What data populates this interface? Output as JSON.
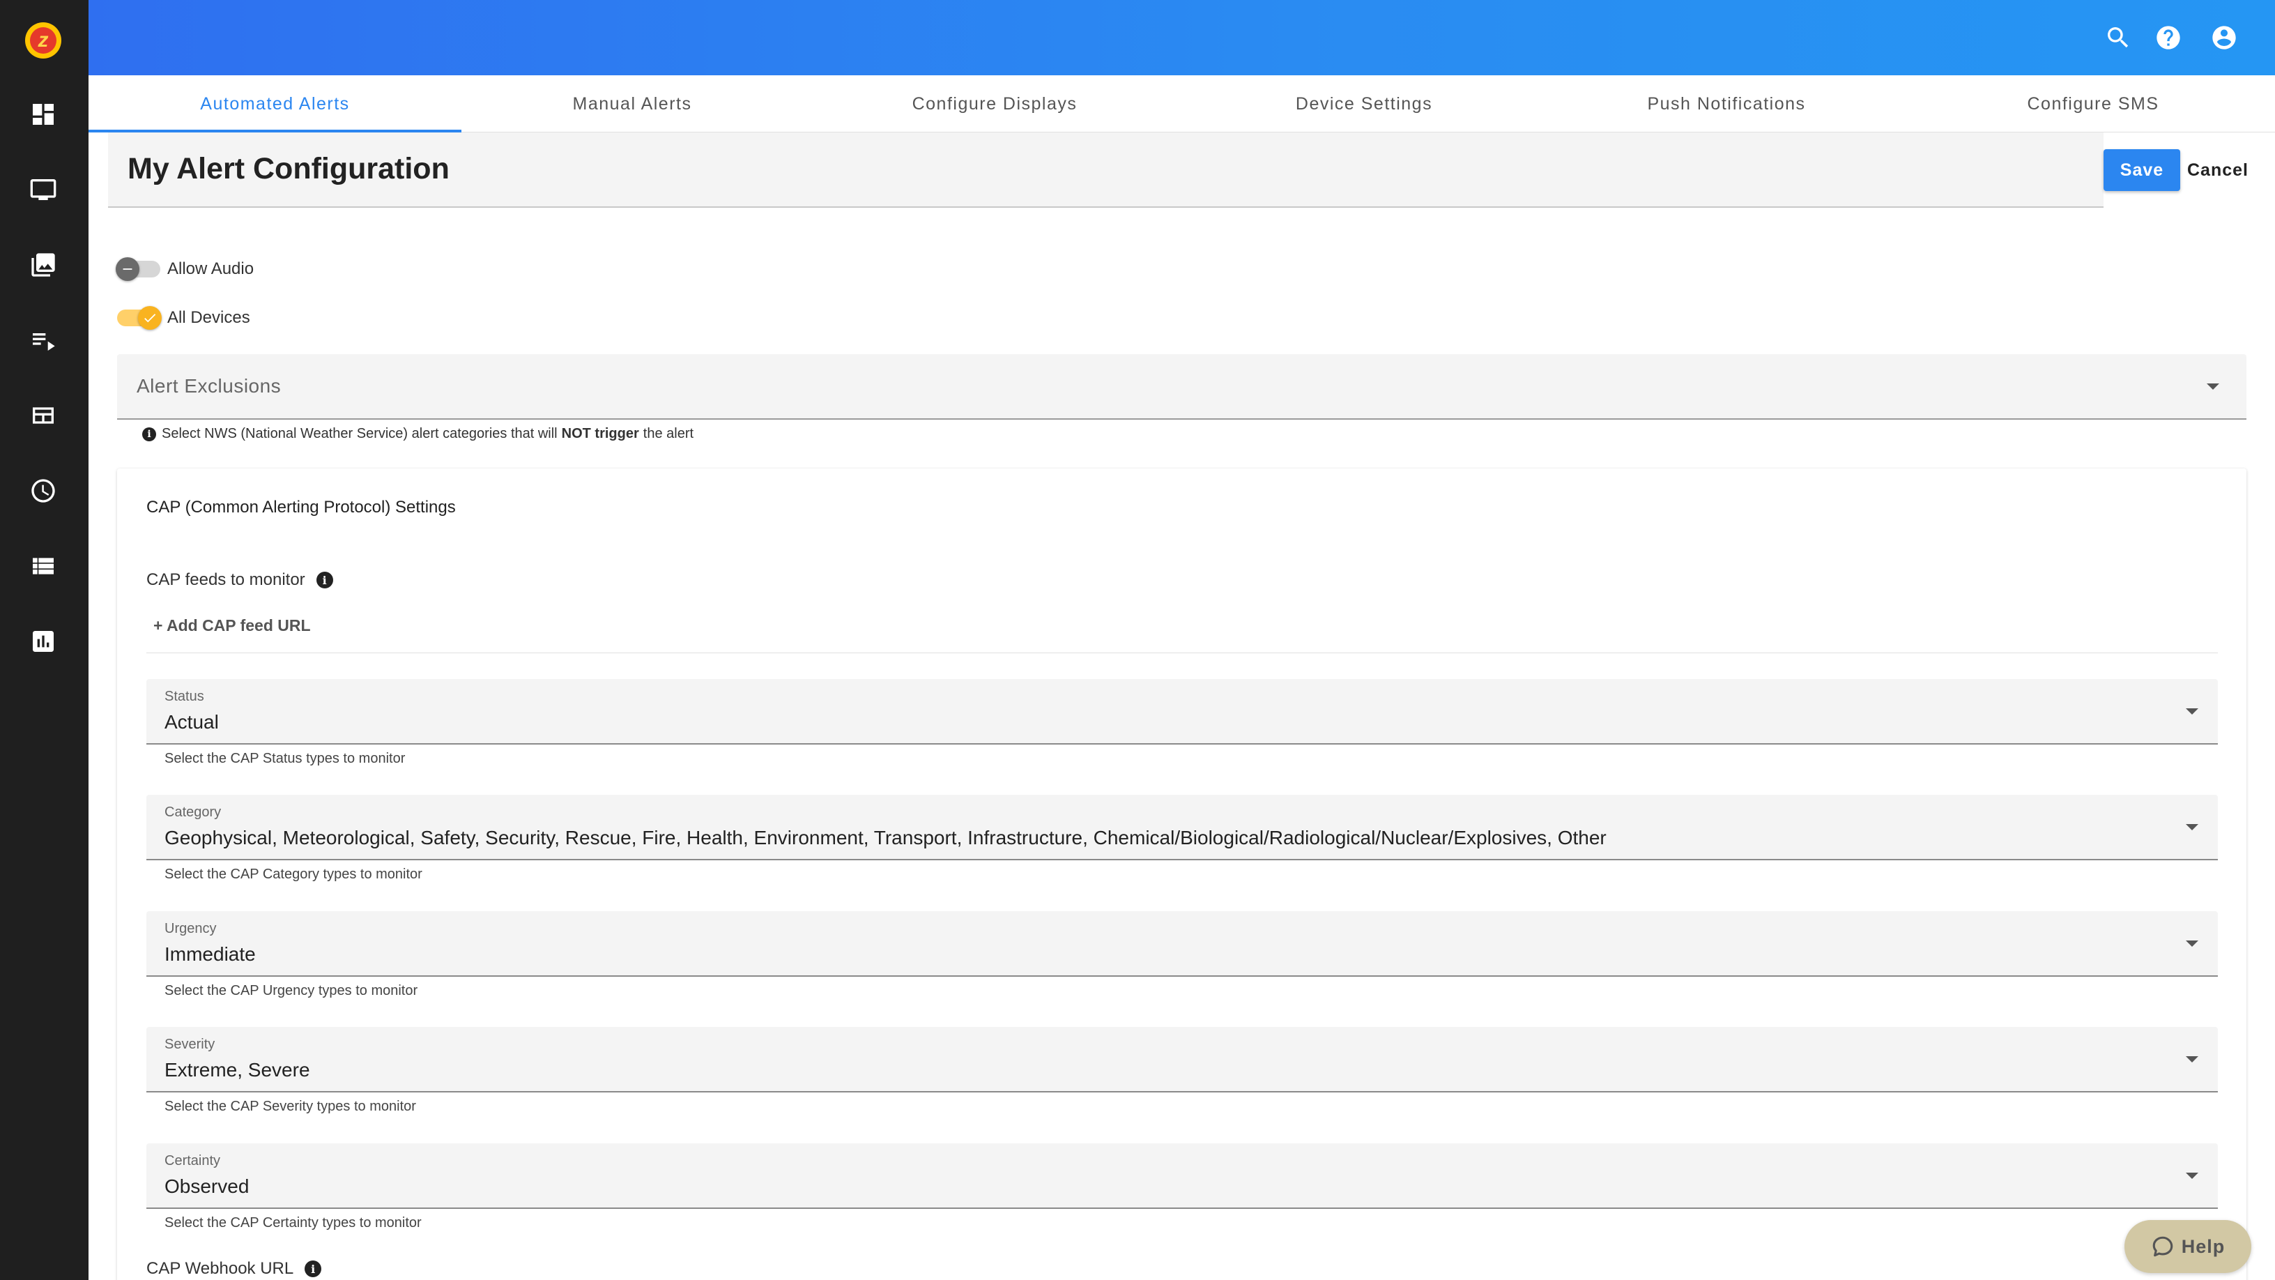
{
  "header": {
    "tabs": [
      {
        "label": "Automated Alerts",
        "active": true
      },
      {
        "label": "Manual Alerts"
      },
      {
        "label": "Configure Displays"
      },
      {
        "label": "Device Settings"
      },
      {
        "label": "Push Notifications"
      },
      {
        "label": "Configure SMS"
      }
    ]
  },
  "page": {
    "title": "My Alert Configuration",
    "save_label": "Save",
    "cancel_label": "Cancel"
  },
  "toggles": {
    "allow_audio": {
      "label": "Allow Audio",
      "on": false
    },
    "all_devices": {
      "label": "All Devices",
      "on": true
    }
  },
  "exclusions": {
    "label": "Alert Exclusions",
    "hint_pre": "Select NWS (National Weather Service) alert categories that will",
    "hint_bold": "NOT trigger",
    "hint_post": "the alert"
  },
  "cap": {
    "title": "CAP (Common Alerting Protocol) Settings",
    "feeds_label": "CAP feeds to monitor",
    "add_feed": "+ Add CAP feed URL",
    "fields": [
      {
        "label": "Status",
        "value": "Actual",
        "hint": "Select the CAP Status types to monitor"
      },
      {
        "label": "Category",
        "value": "Geophysical, Meteorological, Safety, Security, Rescue, Fire, Health, Environment, Transport, Infrastructure, Chemical/Biological/Radiological/Nuclear/Explosives, Other",
        "hint": "Select the CAP Category types to monitor"
      },
      {
        "label": "Urgency",
        "value": "Immediate",
        "hint": "Select the CAP Urgency types to monitor"
      },
      {
        "label": "Severity",
        "value": "Extreme, Severe",
        "hint": "Select the CAP Severity types to monitor"
      },
      {
        "label": "Certainty",
        "value": "Observed",
        "hint": "Select the CAP Certainty types to monitor"
      }
    ],
    "webhook_label": "CAP Webhook URL"
  },
  "help_label": "Help",
  "icons": {
    "sidebar": [
      "dashboard-icon",
      "display-icon",
      "media-library-icon",
      "playlist-icon",
      "layout-icon",
      "schedule-clock-icon",
      "list-icon",
      "analytics-chart-icon"
    ],
    "topbar": [
      "search-icon",
      "help-circle-icon",
      "account-circle-icon"
    ]
  },
  "colors": {
    "accent": "#2b86f0",
    "sidebar_bg": "#1f1f1f",
    "toggle_on": "#f9b320"
  }
}
